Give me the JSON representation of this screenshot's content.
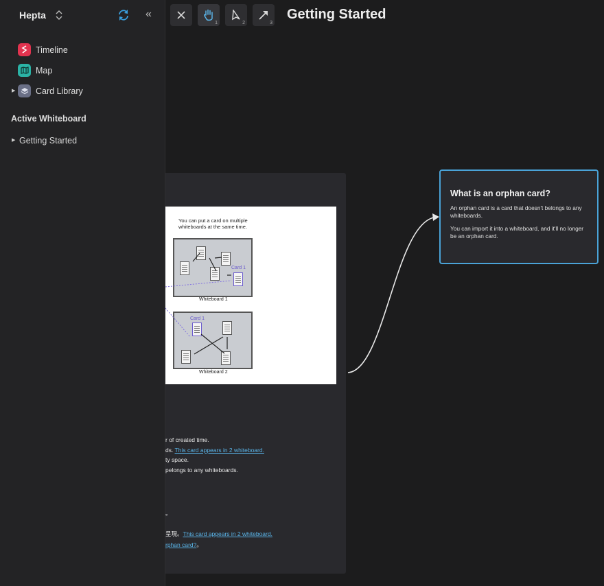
{
  "sidebar": {
    "workspace_name": "Hepta",
    "nav": [
      {
        "label": "Timeline",
        "icon": "timeline-icon"
      },
      {
        "label": "Map",
        "icon": "map-icon"
      },
      {
        "label": "Card Library",
        "icon": "layers-icon"
      }
    ],
    "section_title": "Active Whiteboard",
    "whiteboards": [
      {
        "label": "Getting Started"
      }
    ]
  },
  "toolbar": {
    "close_label": "close",
    "tools": [
      {
        "name": "hand",
        "shortcut": "1"
      },
      {
        "name": "select",
        "shortcut": "2"
      },
      {
        "name": "arrow",
        "shortcut": "3"
      }
    ],
    "title": "Getting Started"
  },
  "canvas": {
    "illustration": {
      "caption": "You can put a card on multiple whiteboards at the same time.",
      "wb1_label": "Whiteboard 1",
      "wb2_label": "Whiteboard 2",
      "card_label": "Card 1"
    },
    "big_card_lines": [
      {
        "text": "r of created time.",
        "link": ""
      },
      {
        "text": "ds. ",
        "link": "This card appears in 2 whiteboard."
      },
      {
        "text": "ty space.",
        "link": ""
      },
      {
        "text": "pelongs to any whiteboards.",
        "link": ""
      },
      {
        "text": "。",
        "link": ""
      },
      {
        "text": "呈現。",
        "link": "This card appears in 2 whiteboard."
      },
      {
        "text": "",
        "link": "rphan card?",
        "suffix": "。"
      }
    ],
    "orphan_card": {
      "title": "What is an orphan card?",
      "p1": "An orphan card is a card that doesn't belongs to any whiteboards.",
      "p2": "You can import it into a whiteboard, and it'll no longer be an orphan card."
    }
  },
  "colors": {
    "accent": "#4aa3d8",
    "sidebar_bg": "#232325",
    "canvas_bg": "#1c1c1d",
    "card_bg": "#29292d"
  }
}
